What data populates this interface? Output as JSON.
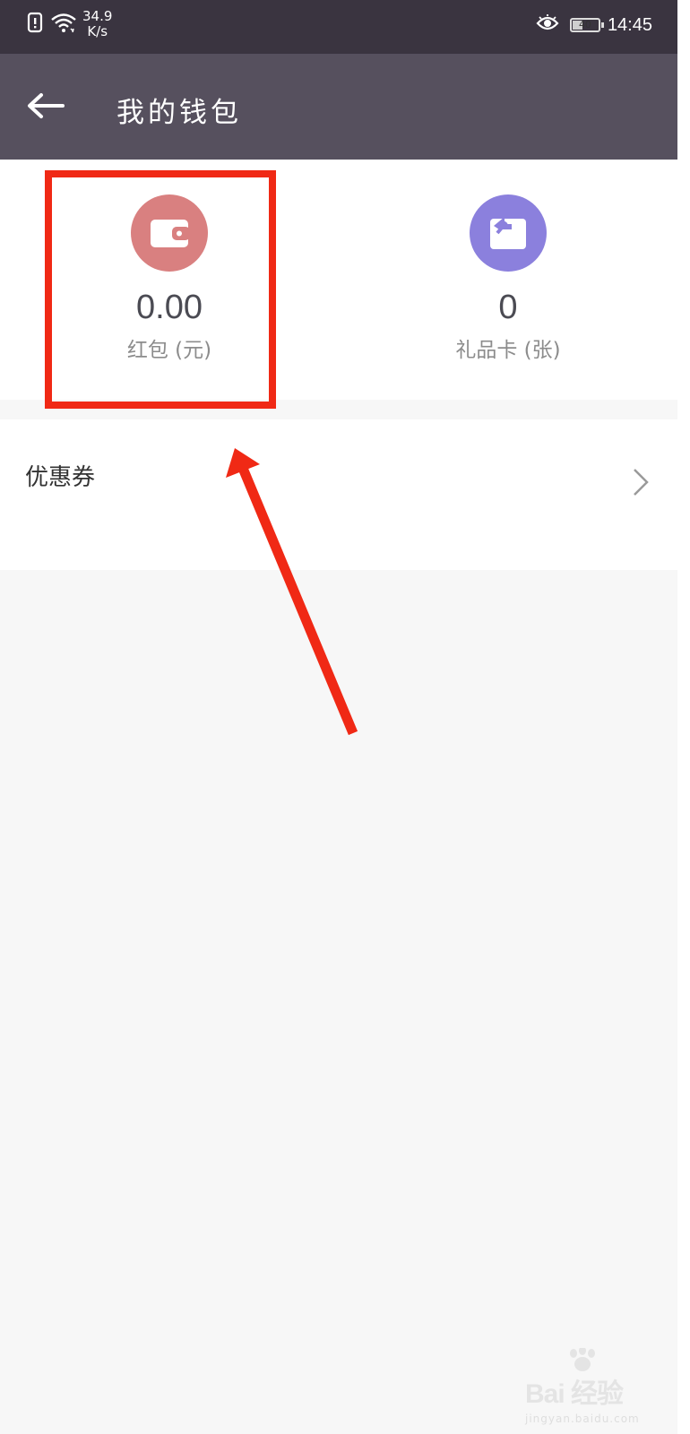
{
  "status_bar": {
    "speed_value": "34.9",
    "speed_unit": "K/s",
    "battery_level": "40",
    "battery_fraction": 0.4,
    "time": "14:45",
    "icons": [
      "sim-alert-icon",
      "wifi-icon",
      "eye-icon",
      "battery-icon"
    ]
  },
  "header": {
    "title": "我的钱包",
    "back_icon": "back-arrow-icon"
  },
  "wallet": {
    "red_packet": {
      "value": "0.00",
      "label": "红包 (元)",
      "icon": "wallet-icon",
      "color": "#d98080"
    },
    "gift_card": {
      "value": "0",
      "label": "礼品卡 (张)",
      "icon": "gift-card-icon",
      "color": "#8b80dd"
    }
  },
  "coupon": {
    "label": "优惠券",
    "icon": "chevron-right-icon"
  },
  "annotation": {
    "highlight_color": "#f02915",
    "arrow_color": "#f02915"
  },
  "watermark": {
    "text": "Bai 经验",
    "subtext": "jingyan.baidu.com"
  }
}
